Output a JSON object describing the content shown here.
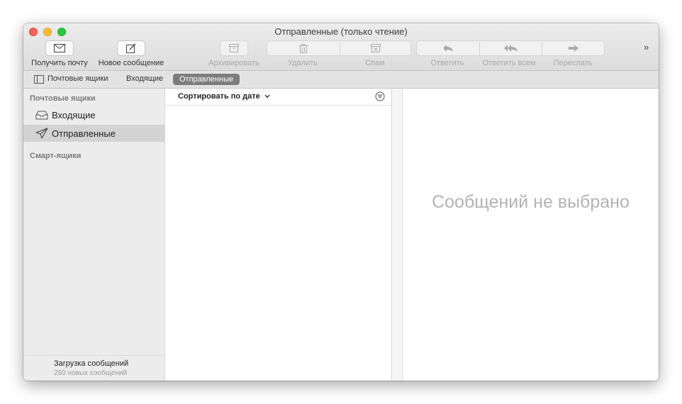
{
  "window": {
    "title": "Отправленные (только чтение)"
  },
  "toolbar": {
    "get_mail": "Получить почту",
    "new_message": "Новое сообщение",
    "archive": "Архивировать",
    "delete": "Удалить",
    "spam": "Спам",
    "reply": "Ответить",
    "reply_all": "Ответить всем",
    "forward": "Переслать",
    "overflow": "»"
  },
  "favorites": {
    "mailboxes": "Почтовые ящики",
    "inbox": "Входящие",
    "sent": "Отправленные"
  },
  "sidebar": {
    "section_mailboxes": "Почтовые ящики",
    "items": [
      {
        "label": "Входящие",
        "icon": "inbox-icon",
        "selected": false
      },
      {
        "label": "Отправленные",
        "icon": "paper-plane-icon",
        "selected": true
      }
    ],
    "section_smart": "Смарт-ящики",
    "status": "Загрузка сообщений",
    "substatus": "260 новых сообщений"
  },
  "message_list": {
    "sort_label": "Сортировать по дате"
  },
  "viewer": {
    "empty_text": "Сообщений не выбрано"
  },
  "colors": {
    "close": "#fe5f57",
    "minimize": "#febc2e",
    "maximize": "#28c840",
    "selected_pill": "#7d7d7d"
  }
}
